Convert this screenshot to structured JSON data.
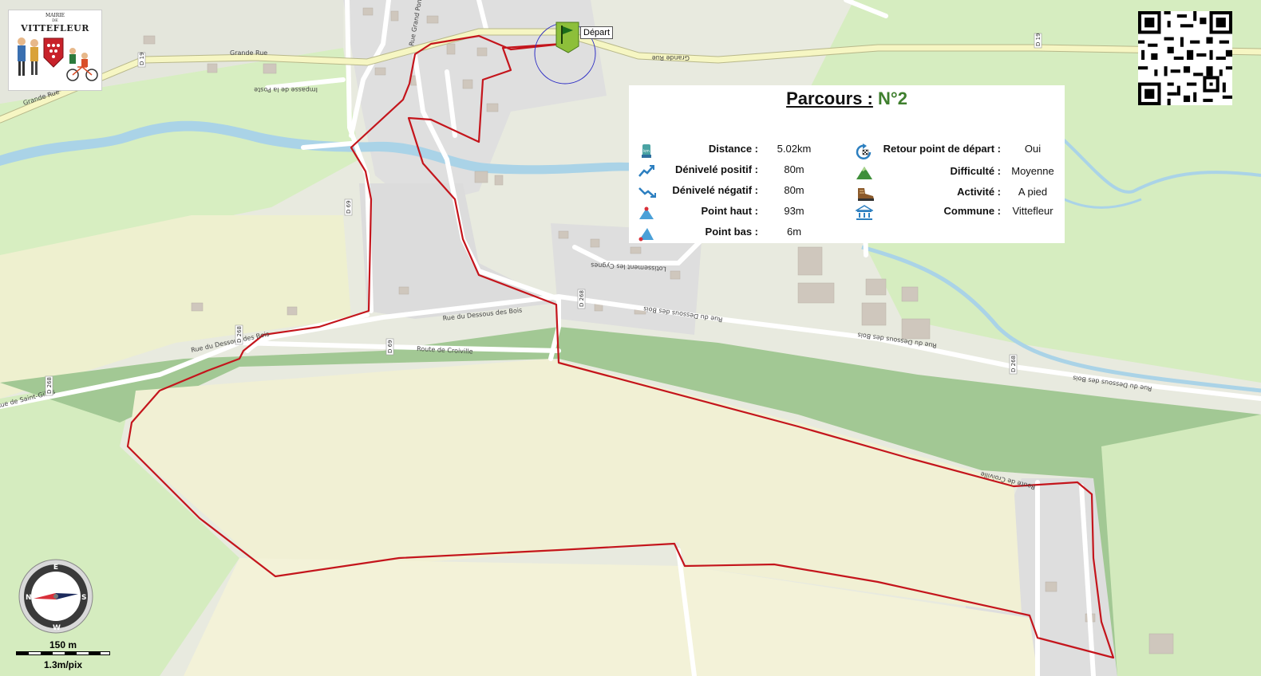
{
  "logo": {
    "line1": "MAIRIE",
    "line2": "DE",
    "town": "VITTEFLEUR"
  },
  "start_marker": {
    "label": "Départ"
  },
  "info": {
    "title_label": "Parcours :",
    "title_number": "N°2",
    "left": [
      {
        "icon": "distance-icon",
        "label": "Distance :",
        "value": "5.02km"
      },
      {
        "icon": "positive-elevation-icon",
        "label": "Dénivelé positif :",
        "value": "80m"
      },
      {
        "icon": "negative-elevation-icon",
        "label": "Dénivelé négatif :",
        "value": "80m"
      },
      {
        "icon": "high-point-icon",
        "label": "Point haut :",
        "value": "93m"
      },
      {
        "icon": "low-point-icon",
        "label": "Point bas :",
        "value": "6m"
      }
    ],
    "right": [
      {
        "icon": "return-start-icon",
        "label": "Retour point de départ :",
        "value": "Oui"
      },
      {
        "icon": "difficulty-icon",
        "label": "Difficulté :",
        "value": "Moyenne"
      },
      {
        "icon": "hiking-boot-icon",
        "label": "Activité :",
        "value": "A pied"
      },
      {
        "icon": "town-hall-icon",
        "label": "Commune :",
        "value": "Vittefleur"
      }
    ]
  },
  "road_labels": {
    "grande_rue_1": "Grande Rue",
    "grande_rue_2": "Grande Rue",
    "grande_rue_3": "Grande Rue",
    "impasse": "Impasse de la Poste",
    "dessous_bois_1": "Rue du Dessous des Bois",
    "dessous_bois_2": "Rue du Dessous des Bois",
    "dessous_bois_3": "Rue du Dessous des Bois",
    "dessous_bois_4": "Rue du Dessous des Bois",
    "dessous_bois_5": "Rue du Dessous des Bois",
    "croiville_1": "Route de Croiville",
    "croiville_2": "Route de Croiville",
    "saint_gilles": "Rue de Saint-Gilles",
    "cygnes": "Lotissement les Cygnes",
    "grand_pont": "Rue Grand Pont",
    "d69_1": "D 69",
    "d69_2": "D 69",
    "d268_1": "D 268",
    "d268_2": "D 268",
    "d268_3": "D 268",
    "d268_4": "D 268",
    "d19_1": "D 19",
    "d19_2": "D 19"
  },
  "compass": {
    "n": "N",
    "e": "E",
    "s": "S",
    "w": "W"
  },
  "scale": {
    "distance": "150 m",
    "resolution": "1.3m/pix"
  },
  "colors": {
    "route": "#c4151c",
    "forest": "#9ec48f",
    "field": "#f1f0d4",
    "meadow": "#d7eec1",
    "river": "#a8d3e6",
    "main_road": "#f6f6c3",
    "title_number": "#3f7f2e"
  }
}
